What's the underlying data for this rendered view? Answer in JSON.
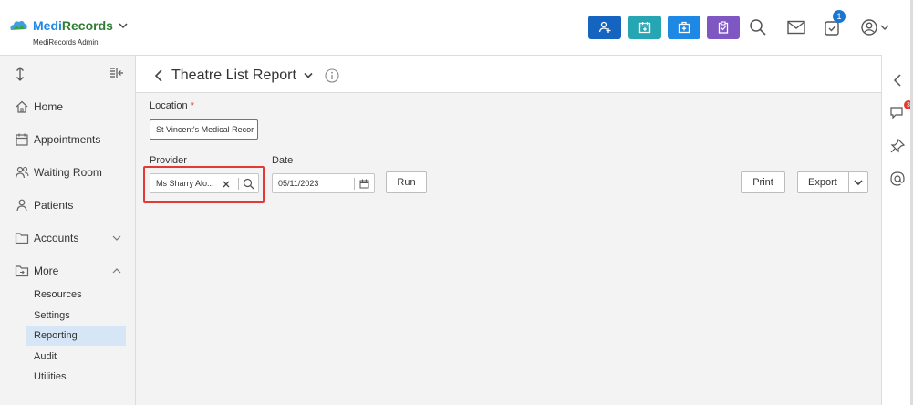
{
  "brand": {
    "name_part1": "Medi",
    "name_part2": "Records",
    "subtitle": "MediRecords Admin"
  },
  "header": {
    "notification_count": "1",
    "action_buttons": [
      {
        "icon": "add-patient-icon",
        "color": "#1565c0"
      },
      {
        "icon": "calendar-icon",
        "color": "#26a6b3"
      },
      {
        "icon": "medical-kit-icon",
        "color": "#1e88e5"
      },
      {
        "icon": "clipboard-icon",
        "color": "#7e57c2"
      }
    ]
  },
  "sidebar": {
    "items": [
      {
        "label": "Home",
        "icon": "home-icon"
      },
      {
        "label": "Appointments",
        "icon": "calendar-icon"
      },
      {
        "label": "Waiting Room",
        "icon": "users-icon"
      },
      {
        "label": "Patients",
        "icon": "patients-icon"
      },
      {
        "label": "Accounts",
        "icon": "folder-icon"
      },
      {
        "label": "More",
        "icon": "folder-more-icon"
      }
    ],
    "sub_items": [
      {
        "label": "Resources"
      },
      {
        "label": "Settings"
      },
      {
        "label": "Reporting",
        "active": true
      },
      {
        "label": "Audit"
      },
      {
        "label": "Utilities"
      }
    ]
  },
  "right_rail": {
    "chat_badge": "3"
  },
  "page": {
    "title": "Theatre List Report"
  },
  "form": {
    "location_label": "Location",
    "location_required": "*",
    "location_value": "St Vincent's Medical Recor",
    "provider_label": "Provider",
    "provider_value": "Ms Sharry Alo...",
    "date_label": "Date",
    "date_value": "05/11/2023",
    "run_label": "Run",
    "print_label": "Print",
    "export_label": "Export"
  }
}
